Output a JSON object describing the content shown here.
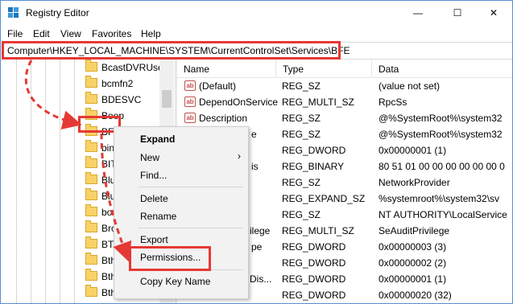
{
  "window": {
    "title": "Registry Editor",
    "minimize_glyph": "—",
    "maximize_glyph": "☐",
    "close_glyph": "✕"
  },
  "menu": [
    "File",
    "Edit",
    "View",
    "Favorites",
    "Help"
  ],
  "address": {
    "path": "Computer\\HKEY_LOCAL_MACHINE\\SYSTEM\\CurrentControlSet\\Services\\BFE"
  },
  "tree": {
    "items": [
      "BcastDVRUserS",
      "bcmfn2",
      "BDESVC",
      "Beep",
      "BFE",
      "bin",
      "BIT",
      "Blu",
      "Blu",
      "bov",
      "Bro",
      "BTA",
      "Bth",
      "Bth",
      "Bth"
    ],
    "selected": "BFE"
  },
  "list": {
    "headers": {
      "name": "Name",
      "type": "Type",
      "data": "Data"
    },
    "rows": [
      {
        "name": "(Default)",
        "type": "REG_SZ",
        "data": "(value not set)",
        "icon": "ab"
      },
      {
        "name": "DependOnService",
        "type": "REG_MULTI_SZ",
        "data": "RpcSs",
        "icon": "ab"
      },
      {
        "name": "Description",
        "type": "REG_SZ",
        "data": "@%SystemRoot%\\system32",
        "icon": "ab"
      },
      {
        "name": "e",
        "type": "REG_SZ",
        "data": "@%SystemRoot%\\system32",
        "icon": "ab"
      },
      {
        "name": "",
        "type": "REG_DWORD",
        "data": "0x00000001 (1)",
        "icon": "bin"
      },
      {
        "name": "is",
        "type": "REG_BINARY",
        "data": "80 51 01 00 00 00 00 00 00 0",
        "icon": "bin"
      },
      {
        "name": "",
        "type": "REG_SZ",
        "data": "NetworkProvider",
        "icon": "ab"
      },
      {
        "name": "",
        "type": "REG_EXPAND_SZ",
        "data": "%systemroot%\\system32\\sv",
        "icon": "ab"
      },
      {
        "name": "",
        "type": "REG_SZ",
        "data": "NT AUTHORITY\\LocalService",
        "icon": "ab"
      },
      {
        "name": "ilege",
        "type": "REG_MULTI_SZ",
        "data": "SeAuditPrivilege",
        "icon": "ab"
      },
      {
        "name": "pe",
        "type": "REG_DWORD",
        "data": "0x00000003 (3)",
        "icon": "bin"
      },
      {
        "name": "",
        "type": "REG_DWORD",
        "data": "0x00000002 (2)",
        "icon": "bin"
      },
      {
        "name": "Dis...",
        "type": "REG_DWORD",
        "data": "0x00000001 (1)",
        "icon": "bin"
      },
      {
        "name": "",
        "type": "REG_DWORD",
        "data": "0x00000020 (32)",
        "icon": "bin"
      }
    ]
  },
  "context_menu": {
    "items": [
      "Expand",
      "New",
      "Find...",
      "Delete",
      "Rename",
      "Export",
      "Permissions...",
      "Copy Key Name"
    ],
    "submenu_glyph": "›"
  },
  "colors": {
    "highlight": "#e53935",
    "folder": "#f7d266"
  }
}
